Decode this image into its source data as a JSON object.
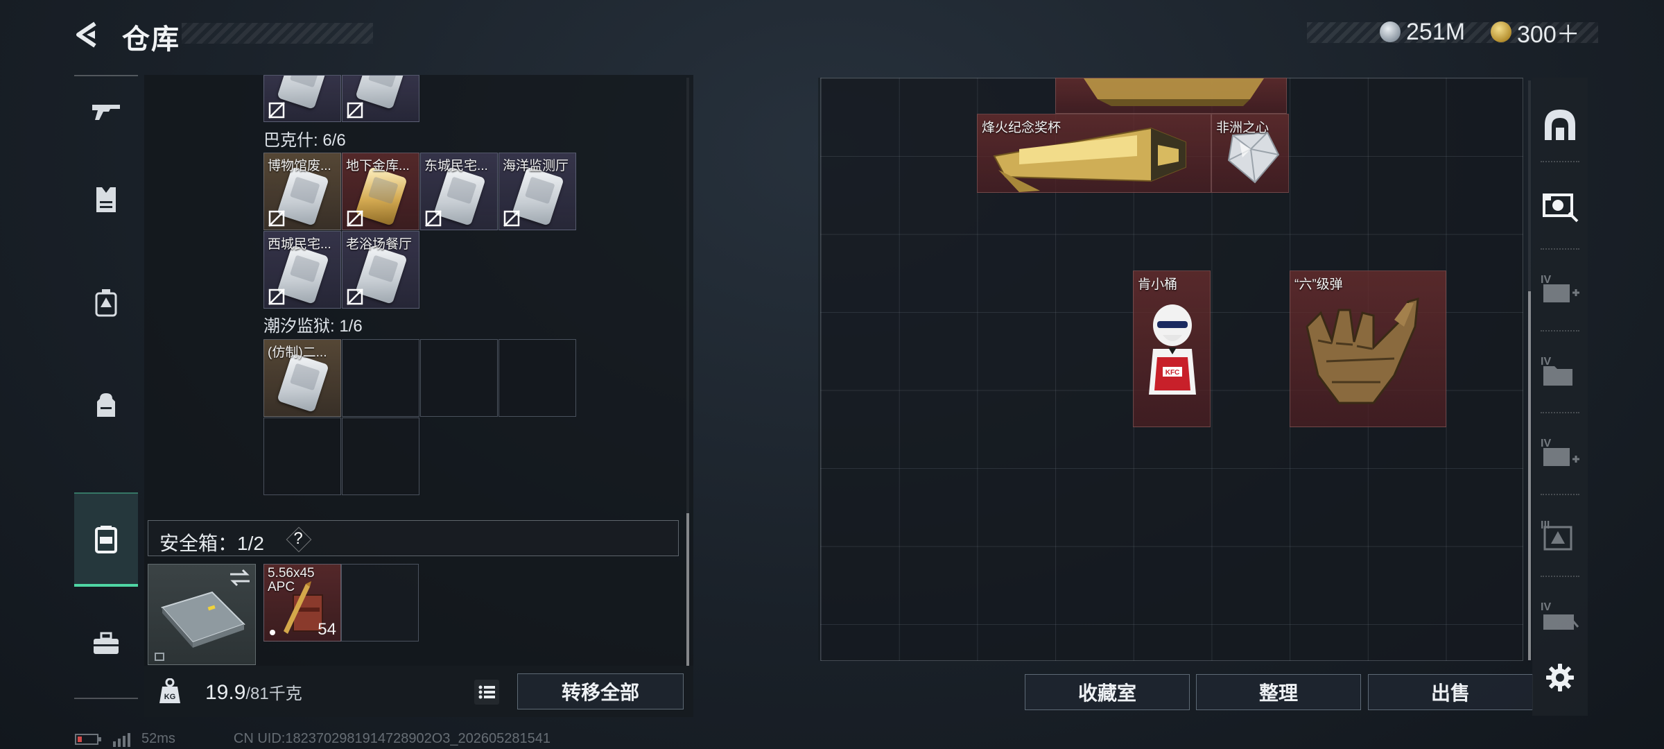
{
  "header": {
    "title": "仓库",
    "currency_silver": "251M",
    "currency_gold": "300＋"
  },
  "nav": {
    "items": [
      "weapon-icon",
      "armor-vest-icon",
      "backpack-rig-icon",
      "backpack-icon",
      "safe-box-icon",
      "toolbox-icon"
    ],
    "active": "safe-box-icon"
  },
  "left_panel": {
    "top_partial_items": [
      "",
      ""
    ],
    "groups": [
      {
        "label": "巴克什: 6/6",
        "items": [
          "博物馆废...",
          "地下金库...",
          "东城民宅...",
          "海洋监测厅",
          "西城民宅...",
          "老浴场餐厅"
        ]
      },
      {
        "label": "潮汐监狱: 1/6",
        "items": [
          "(仿制)二..."
        ]
      }
    ],
    "safe_box": {
      "label": "安全箱：1/2",
      "help": "?",
      "ammo": {
        "name_line1": "5.56x45",
        "name_line2": "APC",
        "count": "54"
      }
    },
    "weight": {
      "current": "19.9",
      "capacity": "/81千克"
    },
    "transfer_all": "转移全部"
  },
  "storage": {
    "items": [
      {
        "name": "",
        "type": "partial-top"
      },
      {
        "name": "烽火纪念奖杯",
        "type": "trophy"
      },
      {
        "name": "非洲之心",
        "type": "gem"
      },
      {
        "name": "肯小桶",
        "type": "figure"
      },
      {
        "name": "“六”级弹",
        "type": "hand-sculpture"
      }
    ]
  },
  "actions": {
    "collection": "收藏室",
    "sort": "整理",
    "sell": "出售"
  },
  "right_toolbar": [
    "dome-icon",
    "fund-tag-icon",
    "add-storage-iv-icon",
    "storage-iv-folder-icon",
    "add-storage-iv-2-icon",
    "storage-iii-icon",
    "storage-iv-locked-icon",
    "settings-gear-icon"
  ],
  "status": {
    "ping": "52ms",
    "uid": "CN UID:1823702981914728902O3_202605281541"
  },
  "colors": {
    "accent_green": "#4fd6a4",
    "red_rarity": "#6b2d2e",
    "gold_rarity": "#785f41",
    "purple_rarity": "#46415f"
  }
}
